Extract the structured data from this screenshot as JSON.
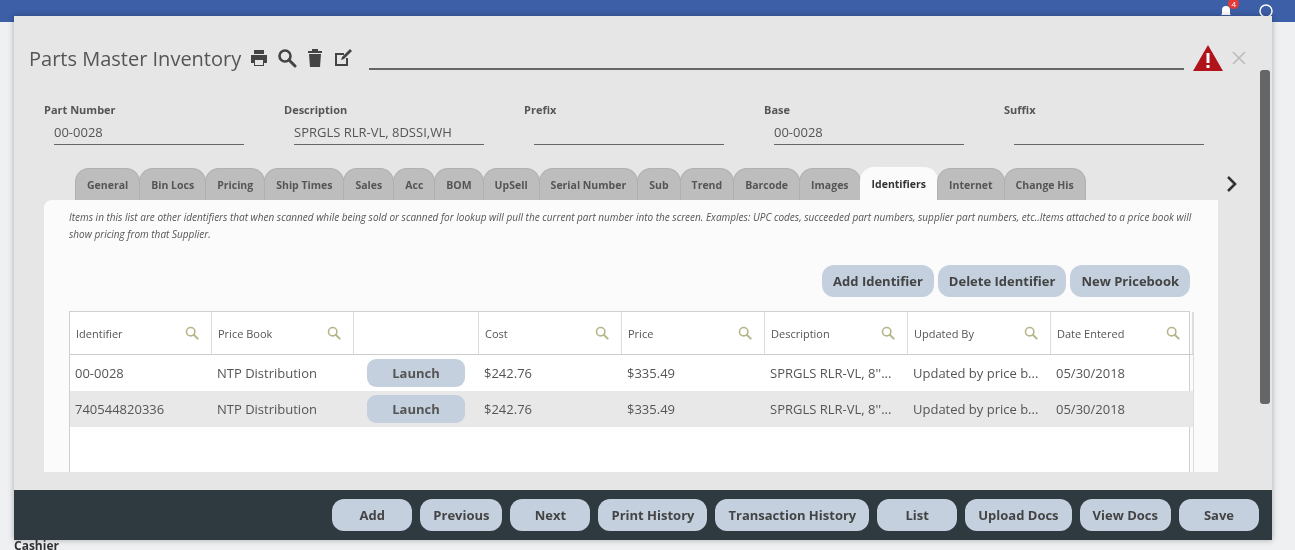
{
  "background_app": {
    "sidebar_label": "Cashier",
    "notification_count": "4"
  },
  "window": {
    "title": "Parts Master Inventory"
  },
  "fields": [
    {
      "label": "Part Number",
      "value": "00-0028"
    },
    {
      "label": "Description",
      "value": "SPRGLS RLR-VL, 8DSSI,WH"
    },
    {
      "label": "Prefix"
    },
    {
      "label": "Base",
      "value": "00-0028"
    },
    {
      "label": "Suffix"
    }
  ],
  "tabs": [
    {
      "label": "General",
      "selected": false
    },
    {
      "label": "Bin Locs",
      "selected": false
    },
    {
      "label": "Pricing",
      "selected": false
    },
    {
      "label": "Ship Times",
      "selected": false
    },
    {
      "label": "Sales",
      "selected": false
    },
    {
      "label": "Acc",
      "selected": false
    },
    {
      "label": "BOM",
      "selected": false
    },
    {
      "label": "UpSell",
      "selected": false
    },
    {
      "label": "Serial Number",
      "selected": false
    },
    {
      "label": "Sub",
      "selected": false
    },
    {
      "label": "Trend",
      "selected": false
    },
    {
      "label": "Barcode",
      "selected": false
    },
    {
      "label": "Images",
      "selected": false
    },
    {
      "label": "Identifiers",
      "selected": true
    },
    {
      "label": "Internet",
      "selected": false
    },
    {
      "label": "Change His",
      "selected": false
    }
  ],
  "panel": {
    "note": "Items in this list are other identifiers that when scanned while being sold or scanned for lookup will pull the current part number into the screen. Examples: UPC codes, succeeded part numbers, supplier part numbers, etc..Items attached to a price book will show pricing from that Supplier.",
    "actions": [
      "Add Identifier",
      "Delete Identifier",
      "New Pricebook"
    ]
  },
  "table": {
    "columns": [
      {
        "label": "Identifier",
        "kind": "text"
      },
      {
        "label": "Price Book",
        "kind": "text"
      },
      {
        "kind": "button"
      },
      {
        "label": "Cost",
        "kind": "text"
      },
      {
        "label": "Price",
        "kind": "text"
      },
      {
        "label": "Description",
        "kind": "text"
      },
      {
        "label": "Updated By",
        "kind": "text"
      },
      {
        "label": "Date Entered",
        "kind": "text"
      }
    ],
    "rows": [
      {
        "cells": [
          "00-0028",
          "NTP Distribution",
          "Launch",
          "$242.76",
          "$335.49",
          "SPRGLS RLR-VL, 8''...",
          "Updated by price b...",
          "05/30/2018"
        ]
      },
      {
        "cells": [
          "740544820336",
          "NTP Distribution",
          "Launch",
          "$242.76",
          "$335.49",
          "SPRGLS RLR-VL, 8''...",
          "Updated by price b...",
          "05/30/2018"
        ]
      }
    ]
  },
  "footer_buttons": [
    "Add",
    "Previous",
    "Next",
    "Print History",
    "Transaction History",
    "List",
    "Upload Docs",
    "View Docs",
    "Save"
  ]
}
